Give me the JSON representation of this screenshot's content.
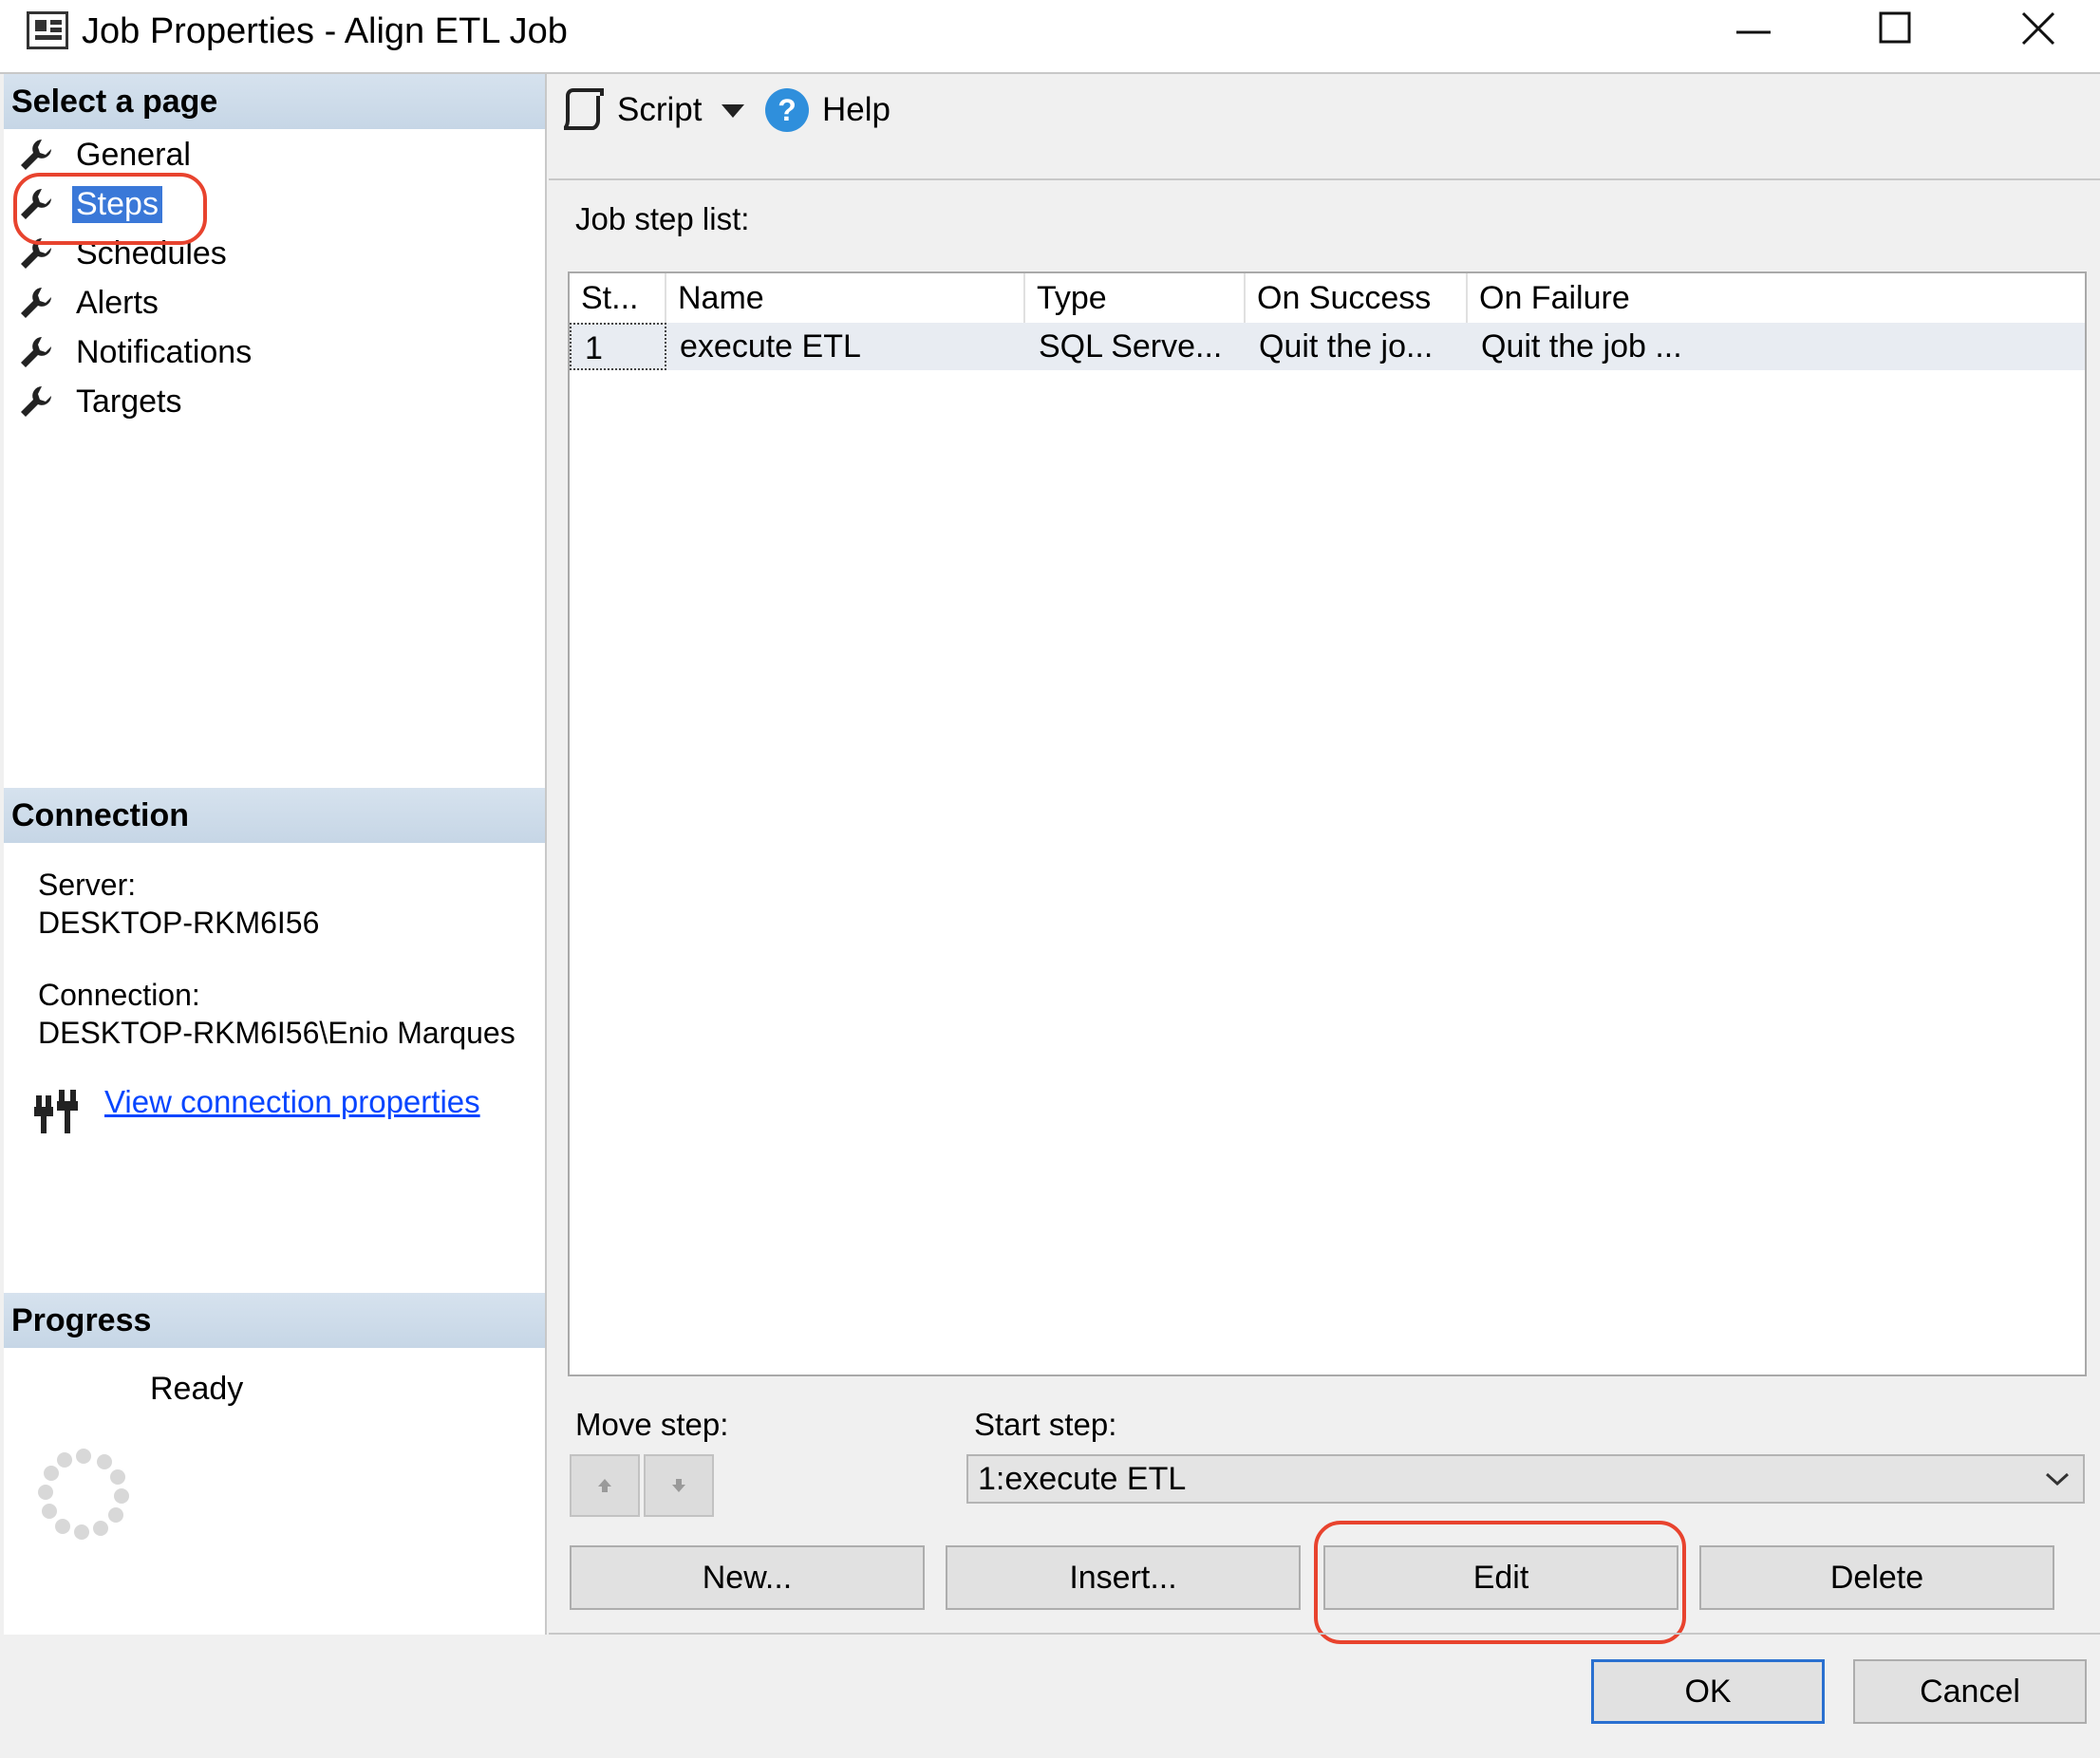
{
  "window": {
    "title": "Job Properties - Align ETL Job"
  },
  "left_panel": {
    "select_page_header": "Select a page",
    "pages": [
      {
        "label": "General",
        "selected": false
      },
      {
        "label": "Steps",
        "selected": true
      },
      {
        "label": "Schedules",
        "selected": false
      },
      {
        "label": "Alerts",
        "selected": false
      },
      {
        "label": "Notifications",
        "selected": false
      },
      {
        "label": "Targets",
        "selected": false
      }
    ],
    "connection_header": "Connection",
    "server_label": "Server:",
    "server_value": "DESKTOP-RKM6I56",
    "connection_label": "Connection:",
    "connection_value": "DESKTOP-RKM6I56\\Enio Marques",
    "view_connection_link": "View connection properties",
    "progress_header": "Progress",
    "progress_status": "Ready"
  },
  "toolbar": {
    "script_label": "Script",
    "help_label": "Help"
  },
  "steps": {
    "list_label": "Job step list:",
    "columns": [
      "St...",
      "Name",
      "Type",
      "On Success",
      "On Failure"
    ],
    "rows": [
      [
        "1",
        "execute ETL",
        "SQL Serve...",
        "Quit the jo...",
        "Quit the job ..."
      ]
    ],
    "move_step_label": "Move step:",
    "start_step_label": "Start step:",
    "start_step_value": "1:execute ETL",
    "new_label": "New...",
    "insert_label": "Insert...",
    "edit_label": "Edit",
    "delete_label": "Delete"
  },
  "dialog_buttons": {
    "ok_label": "OK",
    "cancel_label": "Cancel"
  },
  "colors": {
    "selection": "#3a78d8",
    "highlight_annotation": "#e8432e",
    "link": "#0645ff"
  }
}
